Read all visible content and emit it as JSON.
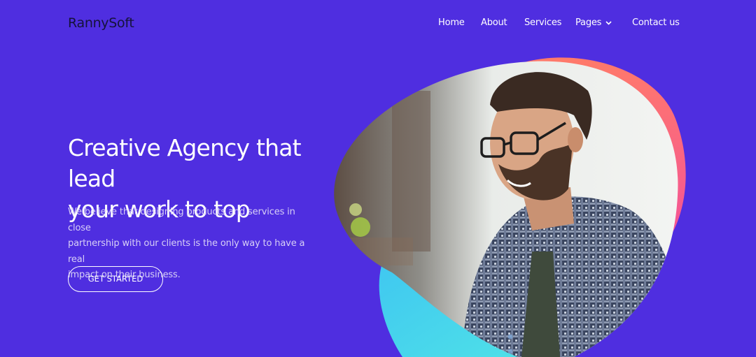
{
  "brand": {
    "name": "RannySoft"
  },
  "nav": {
    "items": [
      {
        "label": "Home"
      },
      {
        "label": "About"
      },
      {
        "label": "Services"
      },
      {
        "label": "Pages",
        "has_dropdown": true
      },
      {
        "label": "Contact us"
      }
    ]
  },
  "hero": {
    "title_line1": "Creative Agency that lead",
    "title_line2": "your work to top",
    "description_line1": "We believe that designing products and services in close",
    "description_line2": "partnership with our clients is the only way to have a real",
    "description_line3": "impact on their business.",
    "cta_label": "GET STARTED"
  },
  "colors": {
    "background": "#4f2ee0",
    "accent_coral": "#ff6f6f",
    "accent_pink": "#f35a8e",
    "accent_cyan": "#44d4ef"
  }
}
